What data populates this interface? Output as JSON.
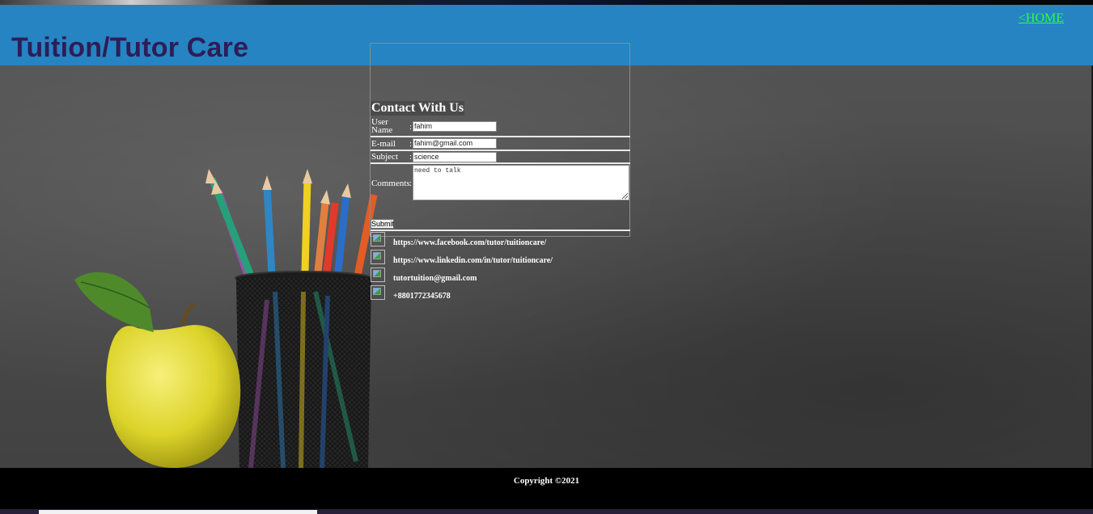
{
  "header": {
    "home_link": "<HOME",
    "site_title": "Tuition/Tutor Care"
  },
  "contact_form": {
    "legend": "Contact With Us",
    "fields": {
      "username": {
        "label_line1": "User",
        "label_line2": "Name",
        "value": "fahim"
      },
      "email": {
        "label": "E-mail",
        "value": "fahim@gmail.com"
      },
      "subject": {
        "label": "Subject",
        "value": "science"
      },
      "comments": {
        "label": "Comments",
        "value": "need to talk"
      }
    },
    "colon": ":",
    "submit_label": "Submit"
  },
  "contacts": [
    {
      "icon": "facebook-icon",
      "text": "https://www.facebook.com/tutor/tuitioncare/"
    },
    {
      "icon": "linkedin-icon",
      "text": "https://www.linkedin.com/in/tutor/tuitioncare/"
    },
    {
      "icon": "email-icon",
      "text": "tutortuition@gmail.com"
    },
    {
      "icon": "phone-icon",
      "text": "+8801772345678"
    }
  ],
  "footer": {
    "copyright": "Copyright ©2021"
  },
  "colors": {
    "header_bg": "#2584c1",
    "title_color": "#2e1d57",
    "home_link": "#2cff45",
    "footer_bg": "#000000"
  }
}
